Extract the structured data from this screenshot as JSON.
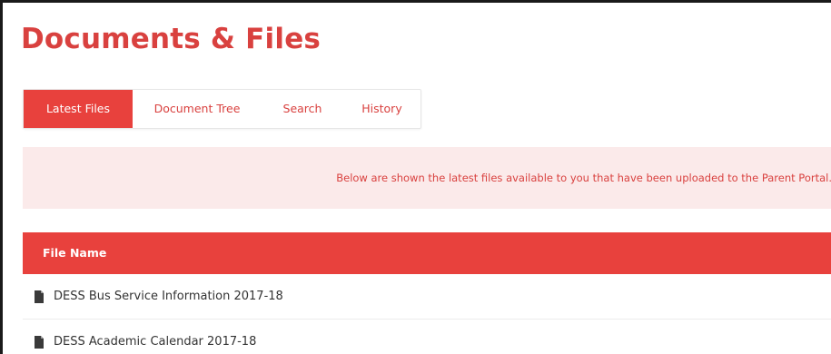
{
  "page": {
    "title": "Documents & Files"
  },
  "tabs": [
    {
      "label": "Latest Files",
      "active": true
    },
    {
      "label": "Document Tree",
      "active": false
    },
    {
      "label": "Search",
      "active": false
    },
    {
      "label": "History",
      "active": false
    }
  ],
  "info": {
    "message": "Below are shown the latest files available to you that have been uploaded to the Parent Portal."
  },
  "table": {
    "header": "File Name",
    "rows": [
      {
        "name": "DESS Bus Service Information 2017-18",
        "icon": "file-icon"
      },
      {
        "name": "DESS Academic Calendar 2017-18",
        "icon": "file-icon"
      }
    ]
  },
  "colors": {
    "accent": "#e8413d",
    "title": "#d9413f",
    "info_background": "#fbeaea"
  }
}
